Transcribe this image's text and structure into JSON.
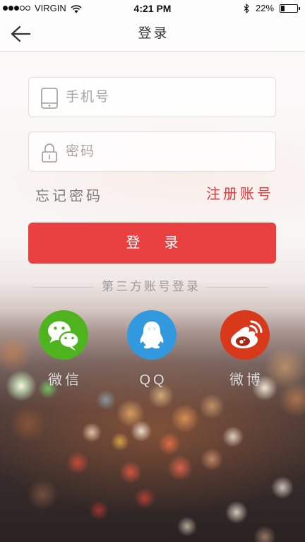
{
  "status_bar": {
    "signal": {
      "level": 3,
      "max": 5
    },
    "carrier": "VIRGIN",
    "wifi_icon": "wifi-icon",
    "time": "4:21 PM",
    "bluetooth_icon": "bluetooth-icon",
    "battery_text": "22%",
    "battery_level": 0.22
  },
  "nav": {
    "back_icon": "arrow-left-icon",
    "title": "登录"
  },
  "form": {
    "phone": {
      "icon": "phone-icon",
      "placeholder": "手机号"
    },
    "password": {
      "icon": "lock-icon",
      "placeholder": "密码"
    },
    "forgot_label": "忘记密码",
    "register_label": "注册账号",
    "login_label": "登录"
  },
  "third_party": {
    "heading": "第三方账号登录",
    "providers": [
      {
        "label": "微信",
        "icon": "wechat-icon",
        "color": "#4fb31f"
      },
      {
        "label": "QQ",
        "icon": "qq-icon",
        "color": "#3399df"
      },
      {
        "label": "微博",
        "icon": "weibo-icon",
        "color": "#d8391b"
      }
    ]
  },
  "colors": {
    "accent": "#e94141",
    "register_link": "#e3393b"
  }
}
